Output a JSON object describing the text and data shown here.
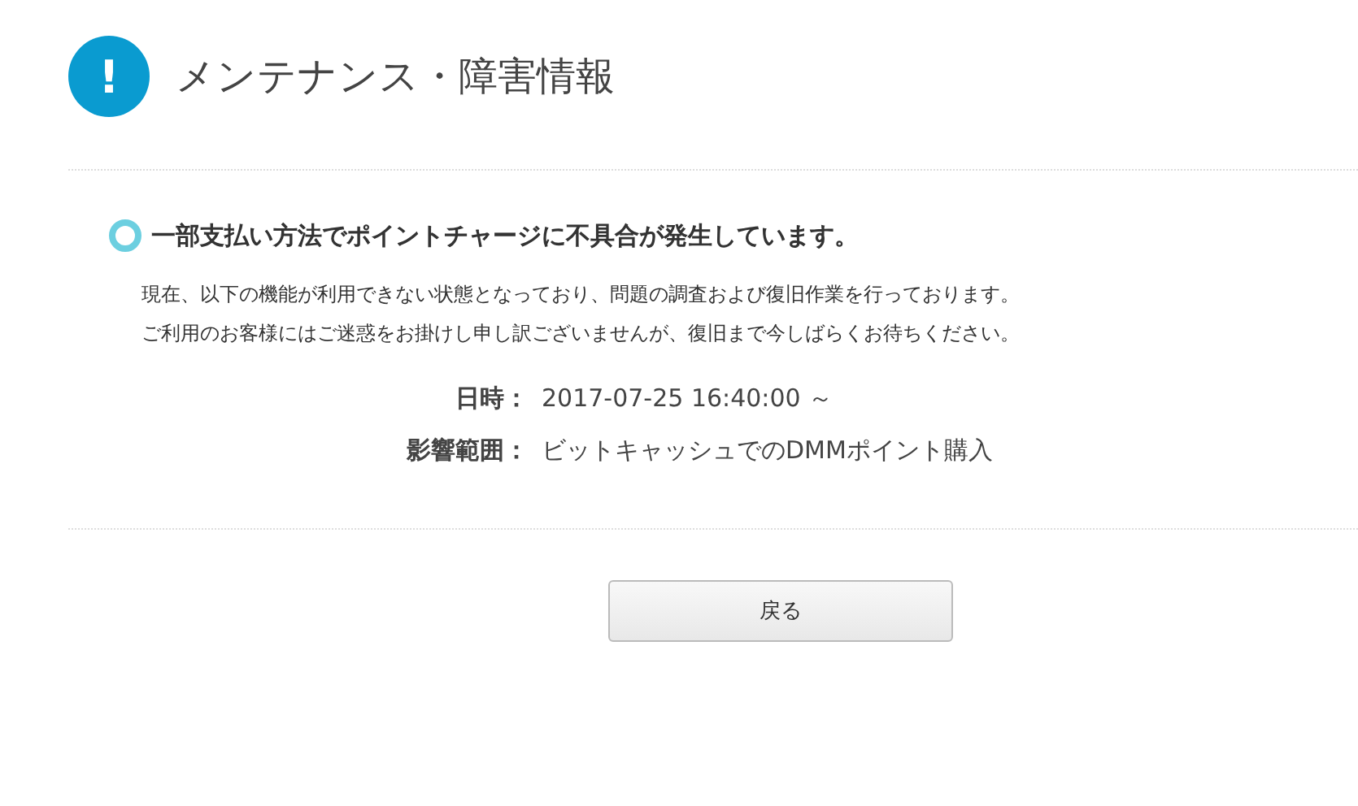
{
  "header": {
    "icon": "!",
    "title": "メンテナンス・障害情報"
  },
  "notice": {
    "title": "一部支払い方法でポイントチャージに不具合が発生しています。",
    "body": [
      "現在、以下の機能が利用できない状態となっており、問題の調査および復旧作業を行っております。",
      "ご利用のお客様にはご迷惑をお掛けし申し訳ございませんが、復旧まで今しばらくお待ちください。"
    ],
    "details": [
      {
        "label": "日時：",
        "value": "2017-07-25 16:40:00 ～"
      },
      {
        "label": "影響範囲：",
        "value": "ビットキャッシュでのDMMポイント購入"
      }
    ]
  },
  "back_button": "戻る"
}
